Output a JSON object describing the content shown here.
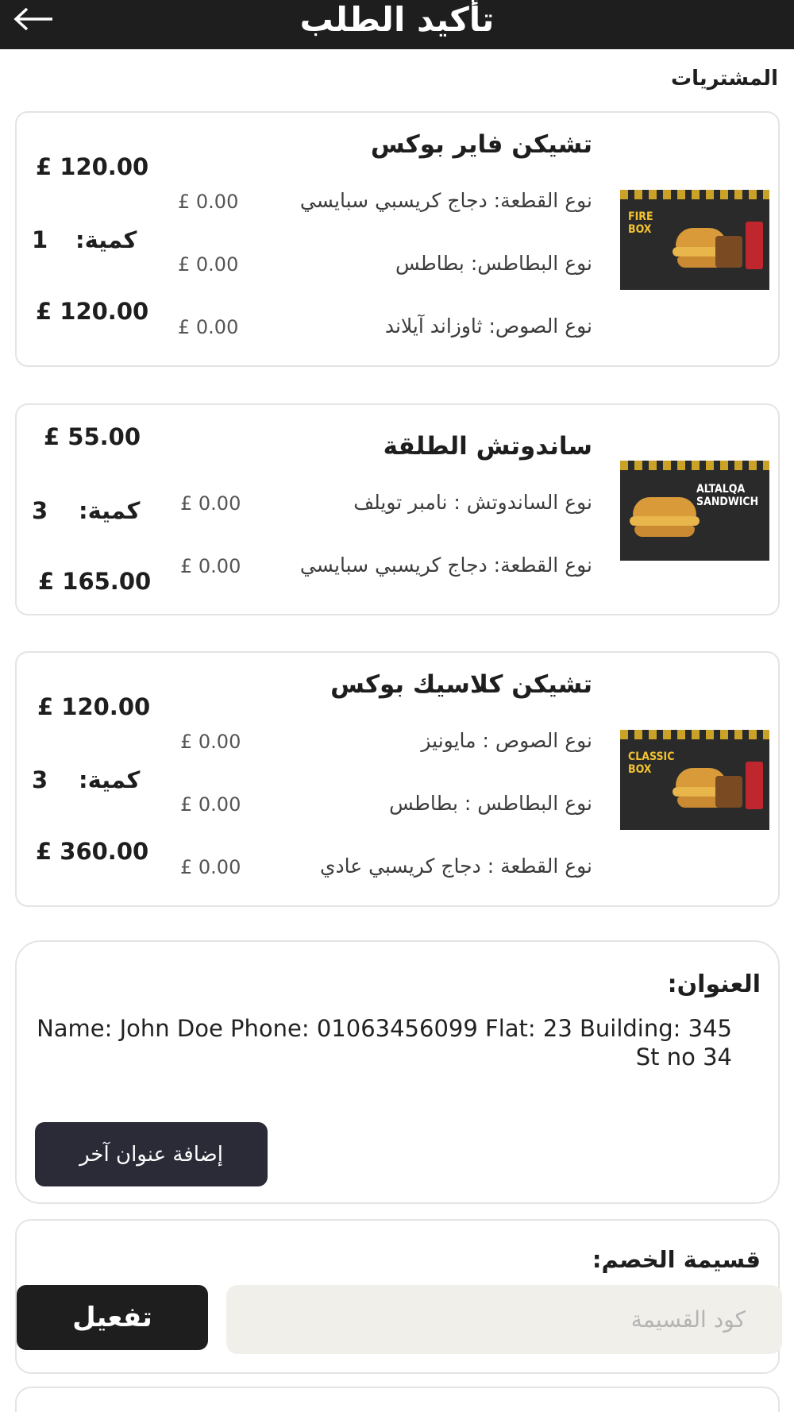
{
  "header": {
    "title": "تأكيد الطلب",
    "back_icon": "arrow-left-icon"
  },
  "purchases_label": "المشتريات",
  "items": [
    {
      "name": "تشيكن فاير بوكس",
      "unit_price": "£ 120.00",
      "qty_label": "كمية:",
      "qty": "1",
      "total": "£ 120.00",
      "thumb_text": "FIRE\nBOX",
      "options": [
        {
          "label": "نوع القطعة: دجاج كريسبي سبايسي",
          "price": "£ 0.00"
        },
        {
          "label": "نوع البطاطس: بطاطس",
          "price": "£ 0.00"
        },
        {
          "label": "نوع الصوص: ثاوزاند آيلاند",
          "price": "£ 0.00"
        }
      ]
    },
    {
      "name": "ساندوتش الطلقة",
      "unit_price": "£ 55.00",
      "qty_label": "كمية:",
      "qty": "3",
      "total": "£ 165.00",
      "thumb_text": "ALTALQA\nSANDWICH",
      "options": [
        {
          "label": "نوع الساندوتش : نامبر تويلف",
          "price": "£ 0.00"
        },
        {
          "label": "نوع القطعة: دجاج كريسبي سبايسي",
          "price": "£ 0.00"
        }
      ]
    },
    {
      "name": "تشيكن كلاسيك بوكس",
      "unit_price": "£ 120.00",
      "qty_label": "كمية:",
      "qty": "3",
      "total": "£ 360.00",
      "thumb_text": "CLASSIC\nBOX",
      "options": [
        {
          "label": "نوع الصوص : مايونيز",
          "price": "£ 0.00"
        },
        {
          "label": "نوع البطاطس : بطاطس",
          "price": "£ 0.00"
        },
        {
          "label": "نوع القطعة : دجاج كريسبي عادي",
          "price": "£ 0.00"
        }
      ]
    }
  ],
  "address": {
    "title": "العنوان:",
    "line1": "Name: John Doe   Phone: 01063456099  Flat: 23  Building: 345",
    "line2": "St no 34",
    "add_button": "إضافة عنوان آخر"
  },
  "coupon": {
    "title": "قسيمة الخصم:",
    "placeholder": "كود القسيمة",
    "value": "",
    "activate_button": "تفعيل"
  },
  "colors": {
    "dark": "#1e1e1e",
    "button_dark": "#2b2b38",
    "input_bg": "#f1efea",
    "card_border": "#e4e4e4"
  }
}
